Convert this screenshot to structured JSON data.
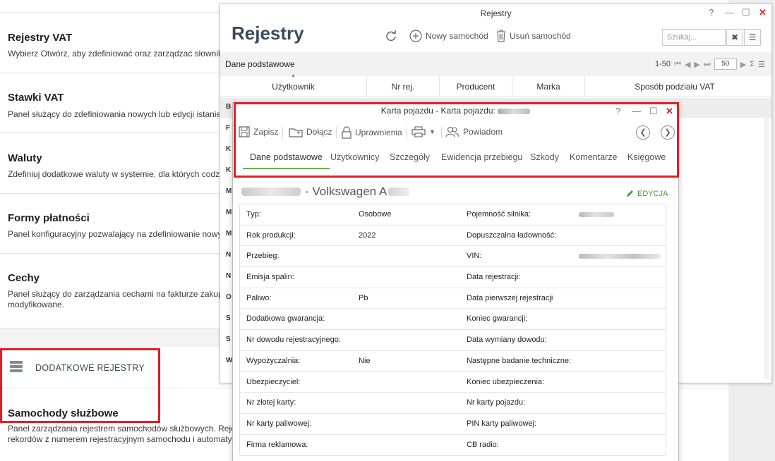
{
  "background": {
    "sections": [
      {
        "title": "Rejestry VAT",
        "desc": "Wybierz Otwórz, aby zdefiniować oraz zarządzać słownikie"
      },
      {
        "title": "Stawki VAT",
        "desc": "Panel służący do zdefiniowania nowych lub edycji istanieją"
      },
      {
        "title": "Waluty",
        "desc": "Zdefiniuj dodatkowe waluty w systemie, dla których codzie"
      },
      {
        "title": "Formy płatności",
        "desc": "Panel konfiguracyjny pozwalający na zdefiniowanie nowycl"
      },
      {
        "title": "Cechy",
        "desc": "Panel służący do zarządzania cechami na fakturze zakupu modyfikowane."
      }
    ],
    "additional_registers_label": "DODATKOWE REJESTRY",
    "samochody": {
      "title": "Samochody służbowe",
      "desc": "Panel zarządzania rejestrem samochodów służbowych. Rejes rekordów z numerem rejestracyjnym samochodu i automatycz"
    }
  },
  "rejestry_window": {
    "title": "Rejestry",
    "big_title": "Rejestry",
    "controls": {
      "help": "?",
      "min": "—",
      "max": "☐",
      "close": "✕"
    },
    "toolbar": {
      "new": "Nowy samochód",
      "delete": "Usuń samochód"
    },
    "search_placeholder": "Szukaj...",
    "subbar_label": "Dane podstawowe",
    "pager": {
      "range": "1-50",
      "page_size": "50"
    },
    "columns": [
      "Użytkownik",
      "Nr rej.",
      "Producent",
      "Marka",
      "Sposób podziału VAT"
    ],
    "row_letters": [
      "B",
      "F",
      "K",
      "K",
      "M",
      "M",
      "M",
      "N",
      "N",
      "O",
      "S",
      "S",
      "W"
    ]
  },
  "karta_window": {
    "title": "Karta pojazdu - Karta pojazdu:",
    "controls": {
      "help": "?",
      "min": "—",
      "max": "☐",
      "close": "✕"
    },
    "toolbar": {
      "save": "Zapisz",
      "attach": "Dołącz",
      "permissions": "Uprawnienia",
      "notify": "Powiadom"
    },
    "tabs": [
      "Dane podstawowe",
      "Użytkownicy",
      "Szczegóły",
      "Ewidencja przebiegu",
      "Szkody",
      "Komentarze",
      "Księgowe"
    ],
    "vehicle_name": "- Volkswagen A",
    "edit_label": "EDYCJA",
    "fields": [
      {
        "l1": "Typ:",
        "v1": "Osobowe",
        "l2": "Pojemność silnika:",
        "v2": ""
      },
      {
        "l1": "Rok produkcji:",
        "v1": "2022",
        "l2": "Dopuszczalna ładowność:",
        "v2": ""
      },
      {
        "l1": "Przebieg:",
        "v1": "",
        "l2": "VIN:",
        "v2": ""
      },
      {
        "l1": "Emisja spalin:",
        "v1": "",
        "l2": "Data rejestracji:",
        "v2": ""
      },
      {
        "l1": "Paliwo:",
        "v1": "Pb",
        "l2": "Data pierwszej rejestracji",
        "v2": ""
      },
      {
        "l1": "Dodatkowa gwarancja:",
        "v1": "",
        "l2": "Koniec gwarancji:",
        "v2": ""
      },
      {
        "l1": "Nr dowodu rejestracyjnego:",
        "v1": "",
        "l2": "Data wymiany dowodu:",
        "v2": ""
      },
      {
        "l1": "Wypożyczalnia:",
        "v1": "Nie",
        "l2": "Następne badanie techniczne:",
        "v2": ""
      },
      {
        "l1": "Ubezpieczyciel:",
        "v1": "",
        "l2": "Koniec ubezpieczenia:",
        "v2": ""
      },
      {
        "l1": "Nr złotej karty:",
        "v1": "",
        "l2": "Nr karty pojazdu:",
        "v2": ""
      },
      {
        "l1": "Nr karty paliwowej:",
        "v1": "",
        "l2": "PIN karty paliwowej:",
        "v2": ""
      },
      {
        "l1": "Firma reklamowa:",
        "v1": "",
        "l2": "CB radio:",
        "v2": ""
      }
    ]
  },
  "colors": {
    "accent_red": "#e01e26",
    "tab_active": "#6ab04c",
    "edit_green": "#4a9a2e",
    "title_navy": "#3b4c5e"
  }
}
